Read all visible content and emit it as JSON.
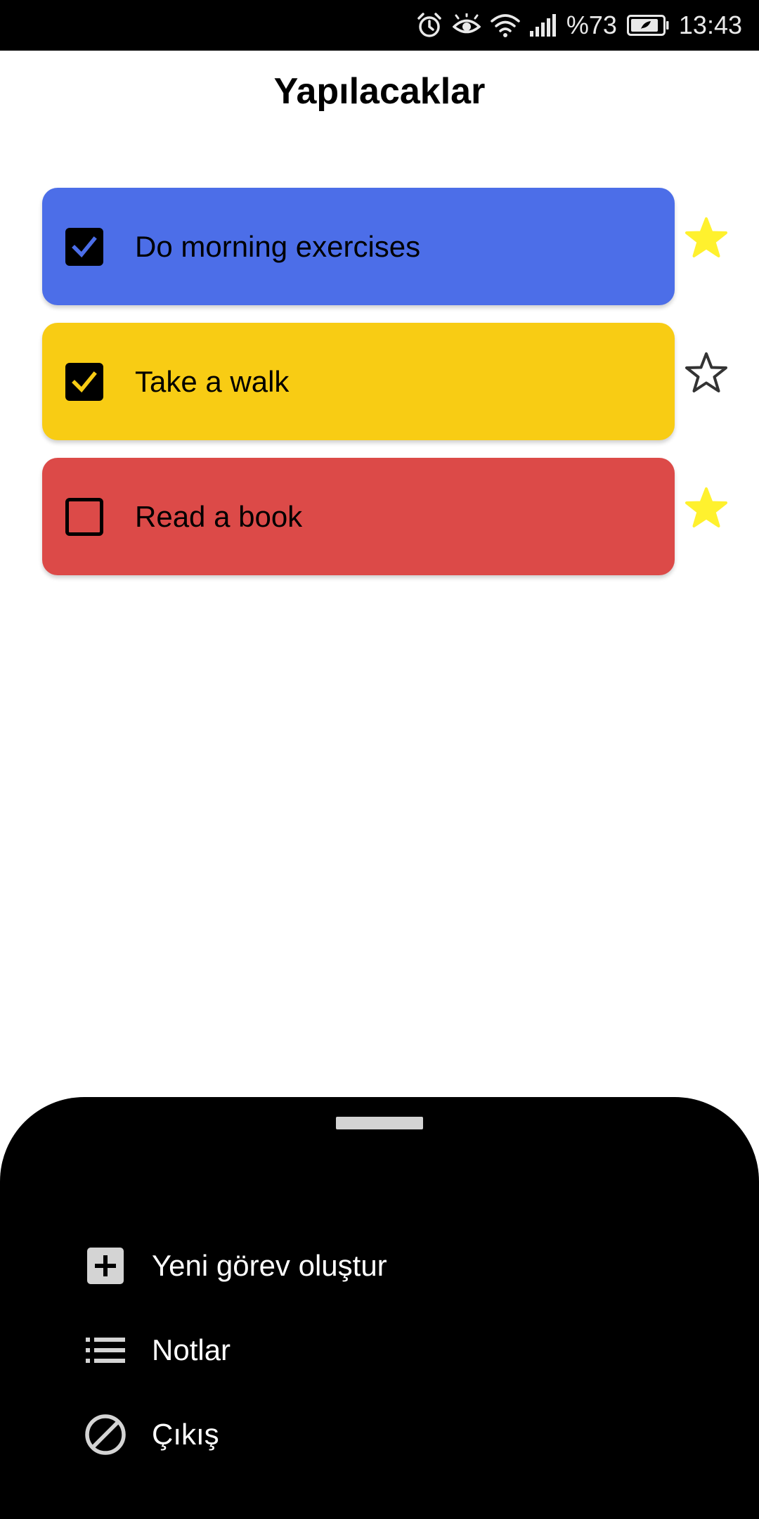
{
  "status_bar": {
    "battery_percent": "%73",
    "time": "13:43",
    "icons": [
      "alarm-icon",
      "eye-comfort-icon",
      "wifi-icon",
      "signal-icon",
      "battery-icon"
    ]
  },
  "header": {
    "title": "Yapılacaklar"
  },
  "tasks": [
    {
      "label": "Do morning exercises",
      "checked": true,
      "starred": true,
      "color": "#4c6ee8",
      "check_color": "#4c6ee8"
    },
    {
      "label": "Take a walk",
      "checked": true,
      "starred": false,
      "color": "#f8cc14",
      "check_color": "#f8cc14"
    },
    {
      "label": "Read a book",
      "checked": false,
      "starred": true,
      "color": "#dc4a48",
      "check_color": "#dc4a48"
    }
  ],
  "colors": {
    "star_filled": "#fff12e",
    "star_outline": "#333333",
    "sheet_background": "#000000",
    "sheet_text": "#ffffff",
    "menu_icon": "#d4d4d4"
  },
  "bottom_sheet": {
    "items": [
      {
        "label": "Yeni görev oluştur",
        "icon": "add-box-icon"
      },
      {
        "label": "Notlar",
        "icon": "list-icon"
      },
      {
        "label": "Çıkış",
        "icon": "block-icon"
      }
    ]
  }
}
